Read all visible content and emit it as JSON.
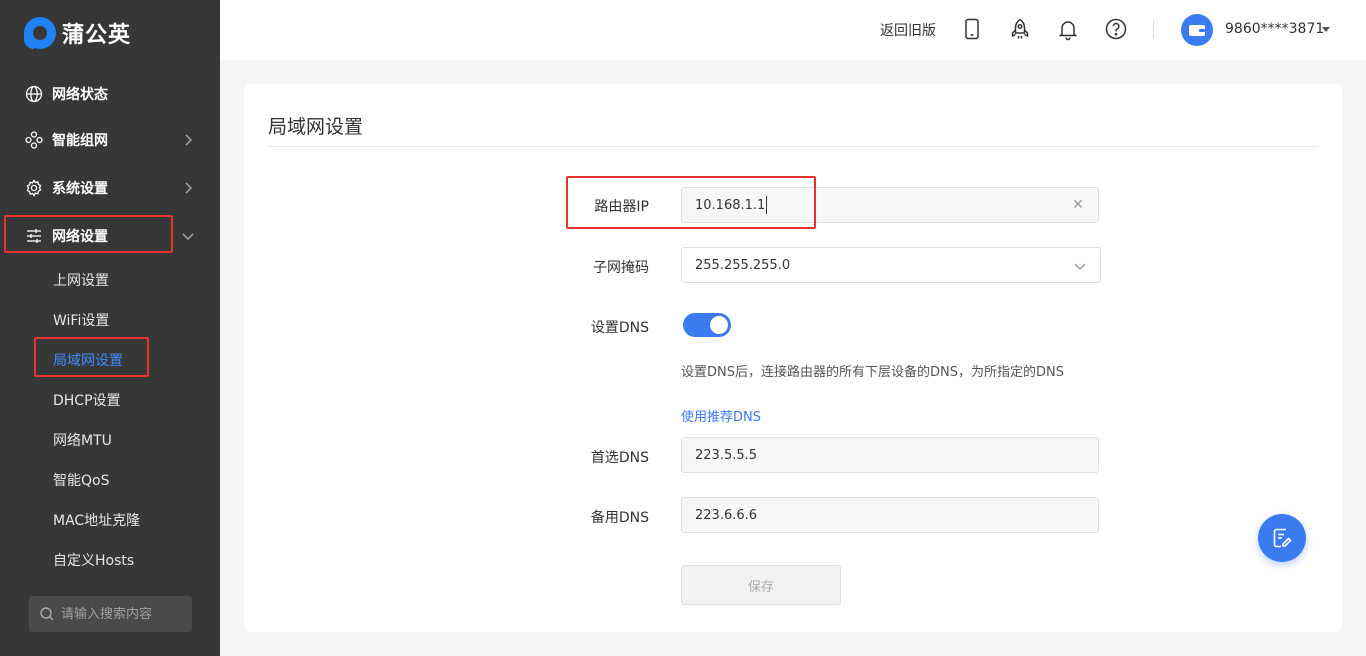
{
  "brand": {
    "name": "蒲公英",
    "accent": "#3a7cf0"
  },
  "sidebar": {
    "items": [
      {
        "label": "网络状态",
        "icon": "globe-icon"
      },
      {
        "label": "智能组网",
        "icon": "network-icon",
        "expandable": true
      },
      {
        "label": "系统设置",
        "icon": "gear-icon",
        "expandable": true
      },
      {
        "label": "网络设置",
        "icon": "sliders-icon",
        "expanded": true
      }
    ],
    "subitems": [
      {
        "label": "上网设置"
      },
      {
        "label": "WiFi设置"
      },
      {
        "label": "局域网设置",
        "active": true
      },
      {
        "label": "DHCP设置"
      },
      {
        "label": "网络MTU"
      },
      {
        "label": "智能QoS"
      },
      {
        "label": "MAC地址克隆"
      },
      {
        "label": "自定义Hosts"
      }
    ],
    "search": {
      "placeholder": "请输入搜索内容"
    }
  },
  "header": {
    "back_old": "返回旧版",
    "user": "9860****3871"
  },
  "page": {
    "title": "局域网设置",
    "router_ip": {
      "label": "路由器IP",
      "value": "10.168.1.1"
    },
    "subnet_mask": {
      "label": "子网掩码",
      "value": "255.255.255.0"
    },
    "dns": {
      "label": "设置DNS",
      "enabled": true,
      "hint": "设置DNS后，连接路由器的所有下层设备的DNS，为所指定的DNS",
      "use_recommended": "使用推荐DNS"
    },
    "primary_dns": {
      "label": "首选DNS",
      "value": "223.5.5.5"
    },
    "secondary_dns": {
      "label": "备用DNS",
      "value": "223.6.6.6"
    },
    "save_label": "保存"
  }
}
